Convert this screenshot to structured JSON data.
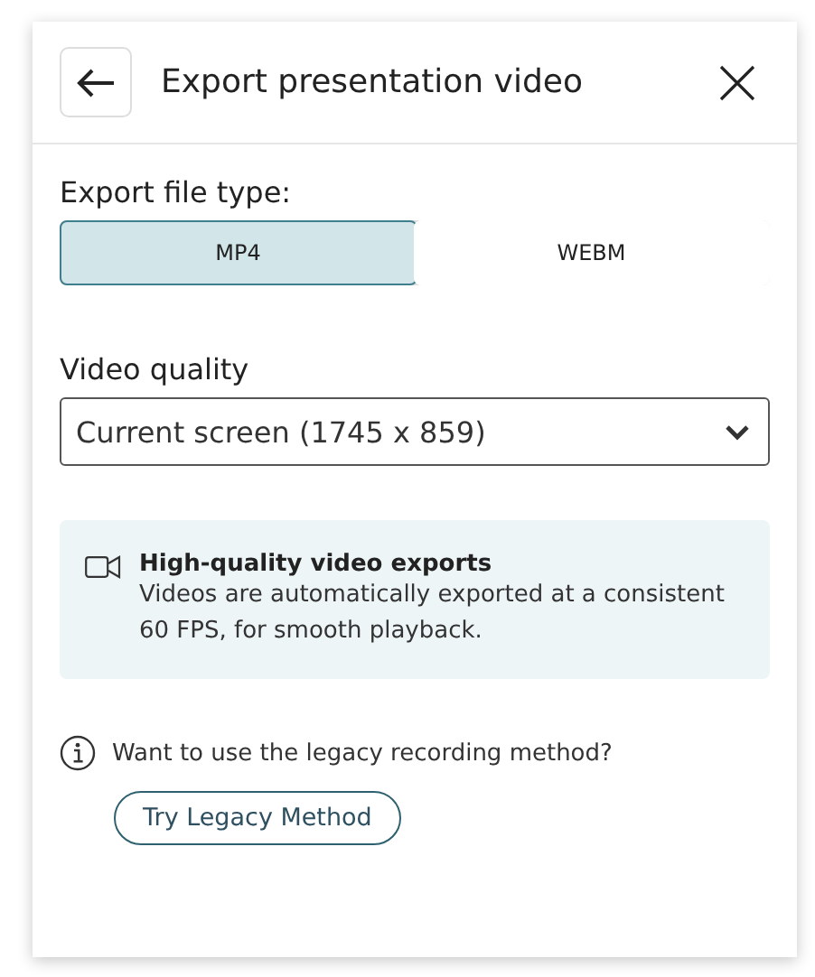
{
  "header": {
    "title": "Export presentation video"
  },
  "file_type": {
    "label": "Export file type:",
    "options": [
      {
        "label": "MP4",
        "selected": true
      },
      {
        "label": "WEBM",
        "selected": false
      }
    ]
  },
  "quality": {
    "label": "Video quality",
    "value": "Current screen (1745 x 859)"
  },
  "notice": {
    "title": "High-quality video exports",
    "text": "Videos are automatically exported at a consistent 60 FPS, for smooth playback."
  },
  "legacy": {
    "question": "Want to use the legacy recording method?",
    "button": "Try Legacy Method"
  }
}
